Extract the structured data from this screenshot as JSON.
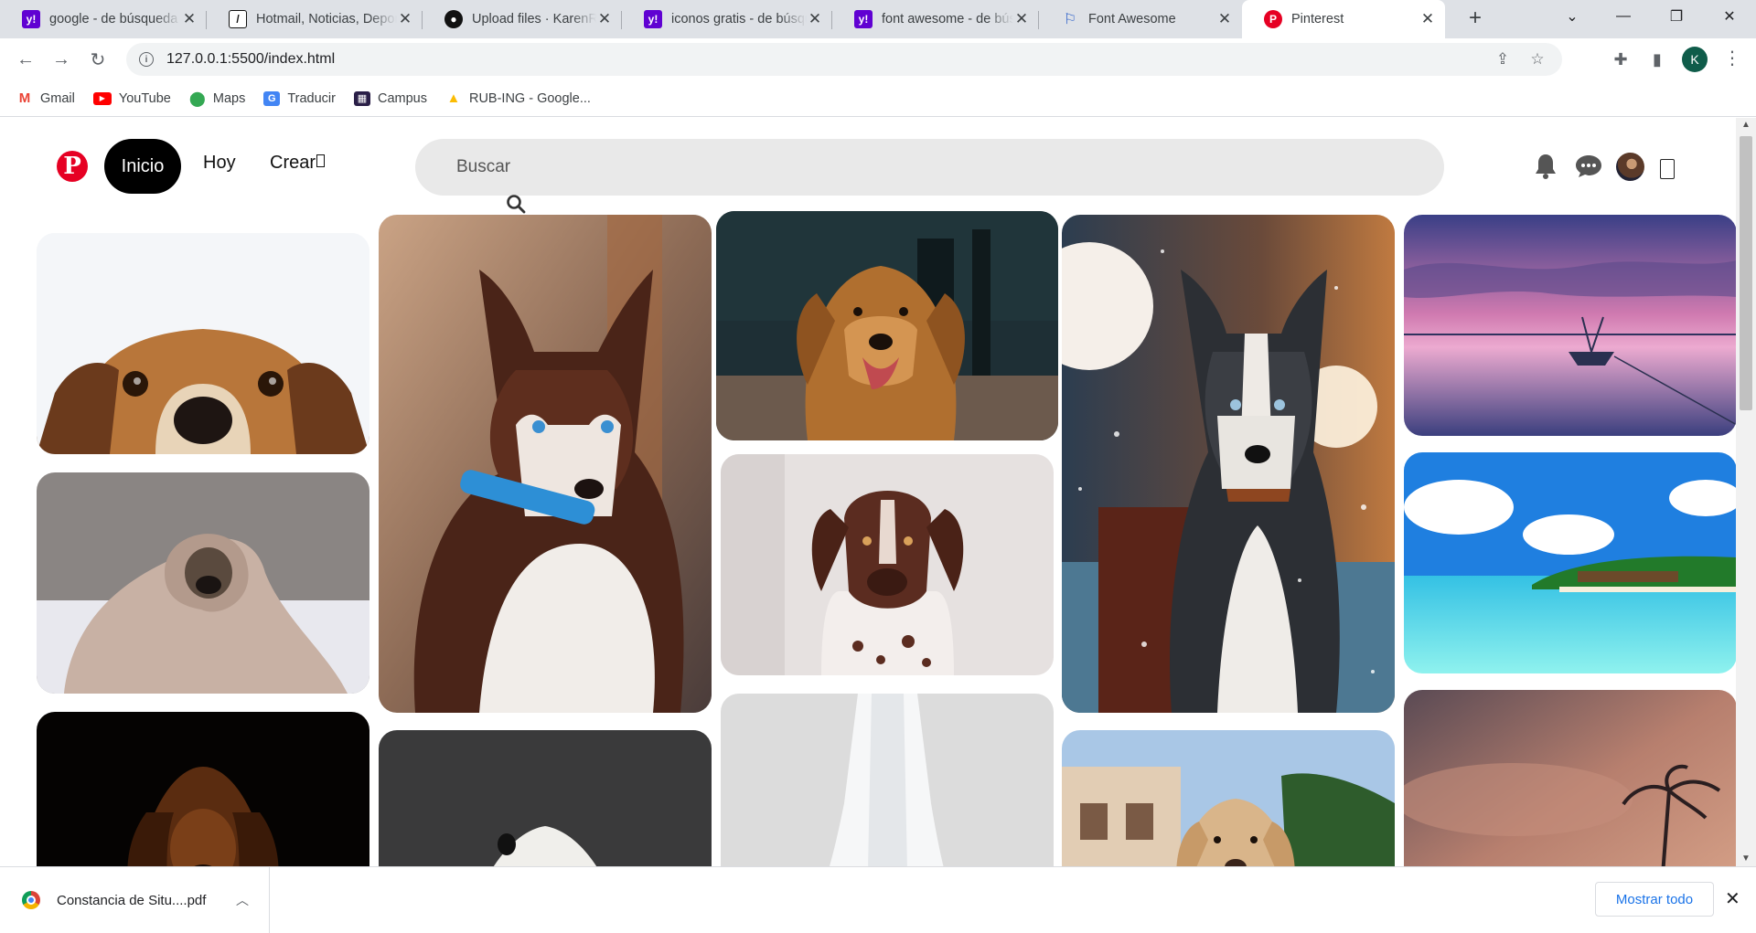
{
  "browser": {
    "tabs": [
      {
        "title": "google - de búsqueda",
        "favicon": "yahoo-icon"
      },
      {
        "title": "Hotmail, Noticias, Deportes",
        "favicon": "hotmail-icon"
      },
      {
        "title": "Upload files · KarenRub",
        "favicon": "github-icon"
      },
      {
        "title": "iconos gratis - de búsqueda",
        "favicon": "yahoo-icon"
      },
      {
        "title": "font awesome - de búsqueda",
        "favicon": "yahoo-icon"
      },
      {
        "title": "Font Awesome",
        "favicon": "font-awesome-flag-icon"
      },
      {
        "title": "Pinterest",
        "favicon": "pinterest-icon",
        "active": true
      }
    ],
    "url": "127.0.0.1:5500/index.html",
    "profile_initial": "K",
    "bookmarks": [
      {
        "label": "Gmail",
        "icon": "gmail-icon"
      },
      {
        "label": "YouTube",
        "icon": "youtube-icon"
      },
      {
        "label": "Maps",
        "icon": "maps-icon"
      },
      {
        "label": "Traducir",
        "icon": "translate-icon"
      },
      {
        "label": "Campus",
        "icon": "campus-icon"
      },
      {
        "label": "RUB-ING - Google...",
        "icon": "google-drive-icon"
      }
    ]
  },
  "page": {
    "nav": {
      "home": "Inicio",
      "today": "Hoy",
      "create": "Crear"
    },
    "search": {
      "placeholder": "Buscar"
    },
    "pins": [
      {
        "subject": "dog-peeking"
      },
      {
        "subject": "pug-blanket"
      },
      {
        "subject": "spaniel-dark"
      },
      {
        "subject": "husky-puppy"
      },
      {
        "subject": "white-dog-dark"
      },
      {
        "subject": "golden-retriever"
      },
      {
        "subject": "pointer-dog"
      },
      {
        "subject": "towel"
      },
      {
        "subject": "husky-snow"
      },
      {
        "subject": "retriever-outdoor"
      },
      {
        "subject": "sunset-boat"
      },
      {
        "subject": "tropical-beach"
      },
      {
        "subject": "cloudy-sunset"
      }
    ]
  },
  "downloads": {
    "file": "Constancia de Situ....pdf",
    "show_all": "Mostrar todo"
  },
  "colors": {
    "pinterest_red": "#e60023",
    "chrome_tabstrip": "#dee1e6",
    "link_blue": "#1a73e8"
  }
}
